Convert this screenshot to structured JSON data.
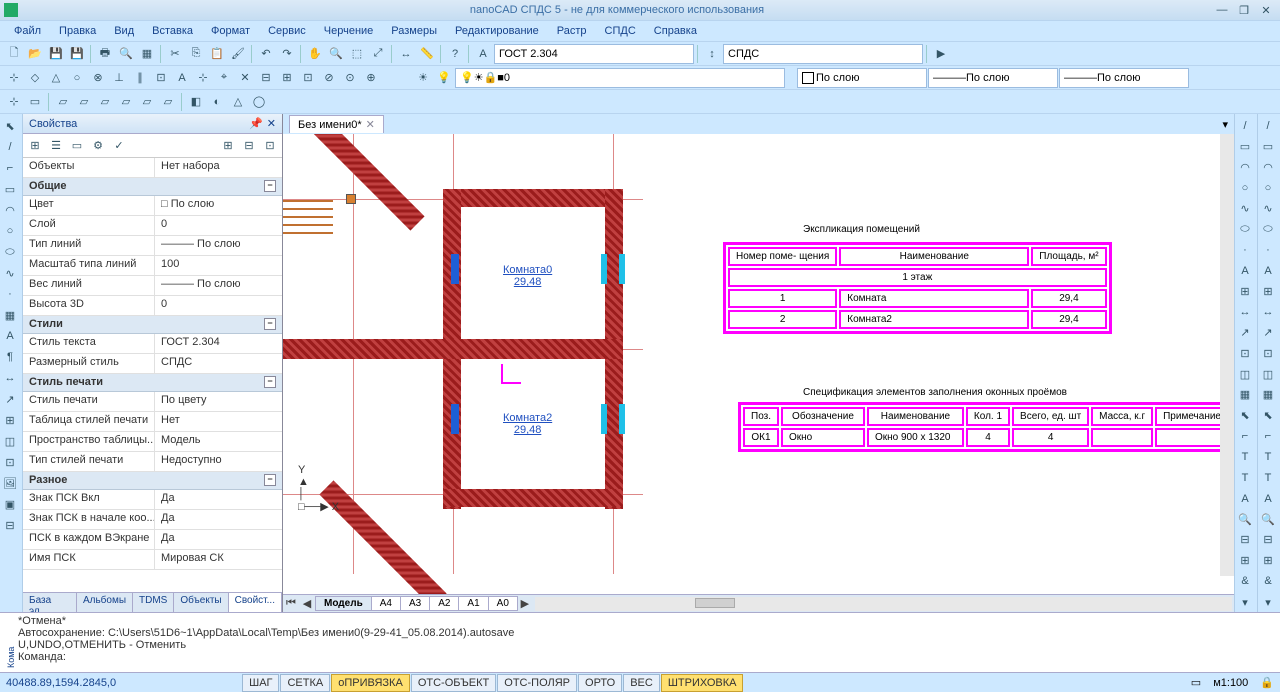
{
  "title": "nanoCAD СПДС 5 - не для коммерческого использования",
  "menu": [
    "Файл",
    "Правка",
    "Вид",
    "Вставка",
    "Формат",
    "Сервис",
    "Черчение",
    "Размеры",
    "Редактирование",
    "Растр",
    "СПДС",
    "Справка"
  ],
  "style_text_combo": "ГОСТ 2.304",
  "style_dim_combo": "СПДС",
  "layer_combo": "0",
  "bylayer1": "По слою",
  "bylayer2": "По слою",
  "bylayer3": "По слою",
  "props": {
    "title": "Свойства",
    "objects_label": "Объекты",
    "objects_value": "Нет набора",
    "cat_general": "Общие",
    "rows_general": [
      {
        "l": "Цвет",
        "v": "□ По слою"
      },
      {
        "l": "Слой",
        "v": "0"
      },
      {
        "l": "Тип линий",
        "v": "――― По слою"
      },
      {
        "l": "Масштаб типа линий",
        "v": "100"
      },
      {
        "l": "Вес линий",
        "v": "――― По слою"
      },
      {
        "l": "Высота 3D",
        "v": "0"
      }
    ],
    "cat_styles": "Стили",
    "rows_styles": [
      {
        "l": "Стиль текста",
        "v": "ГОСТ 2.304"
      },
      {
        "l": "Размерный стиль",
        "v": "СПДС"
      }
    ],
    "cat_print": "Стиль печати",
    "rows_print": [
      {
        "l": "Стиль печати",
        "v": "По цвету"
      },
      {
        "l": "Таблица стилей печати",
        "v": "Нет"
      },
      {
        "l": "Пространство таблицы...",
        "v": "Модель"
      },
      {
        "l": "Тип стилей печати",
        "v": "Недоступно"
      }
    ],
    "cat_misc": "Разное",
    "rows_misc": [
      {
        "l": "Знак ПСК Вкл",
        "v": "Да"
      },
      {
        "l": "Знак ПСК в начале коо...",
        "v": "Да"
      },
      {
        "l": "ПСК в каждом ВЭкране",
        "v": "Да"
      },
      {
        "l": "Имя ПСК",
        "v": "Мировая СК"
      }
    ],
    "tabs": [
      "База эл...",
      "Альбомы",
      "TDMS",
      "Объекты",
      "Свойст..."
    ]
  },
  "doc_tab": "Без имени0*",
  "model_tabs": [
    "Модель",
    "A4",
    "A3",
    "A2",
    "A1",
    "A0"
  ],
  "cmd": {
    "l1": "*Отмена*",
    "l2": "Автосохранение: C:\\Users\\51D6~1\\AppData\\Local\\Temp\\Без имени0(9-29-41_05.08.2014).autosave",
    "l3": "U,UNDO,ОТМЕНИТЬ - Отменить",
    "l4": "Команда:",
    "side": "Кома"
  },
  "status": {
    "coord": "40488.89,1594.2845,0",
    "btns": [
      {
        "t": "ШАГ",
        "on": false
      },
      {
        "t": "СЕТКА",
        "on": false
      },
      {
        "t": "оПРИВЯЗКА",
        "on": true
      },
      {
        "t": "ОТС-ОБЪЕКТ",
        "on": false
      },
      {
        "t": "ОТС-ПОЛЯР",
        "on": false
      },
      {
        "t": "ОРТО",
        "on": false
      },
      {
        "t": "ВЕС",
        "on": false
      },
      {
        "t": "ШТРИХОВКА",
        "on": true
      }
    ],
    "scale": "м1:100"
  },
  "canvas": {
    "room1": {
      "name": "Комната0",
      "area": "29,48"
    },
    "room2": {
      "name": "Комната2",
      "area": "29,48"
    },
    "expl_title": "Экспликация помещений",
    "expl_h": [
      "Номер\nпоме-\nщения",
      "Наименование",
      "Площадь,\nм²"
    ],
    "expl_floor": "1 этаж",
    "expl_rows": [
      [
        "1",
        "Комната",
        "29,4"
      ],
      [
        "2",
        "Комната2",
        "29,4"
      ]
    ],
    "spec_title": "Спецификация элементов заполнения оконных проёмов",
    "spec_h": [
      "Поз.",
      "Обозначение",
      "Наименование",
      "Кол.\n1",
      "Всего,\nед. шт",
      "Масса,\nк.г",
      "Примечание"
    ],
    "spec_row": [
      "ОК1",
      "Окно",
      "Окно 900 х 1320",
      "4",
      "4",
      "",
      ""
    ]
  }
}
